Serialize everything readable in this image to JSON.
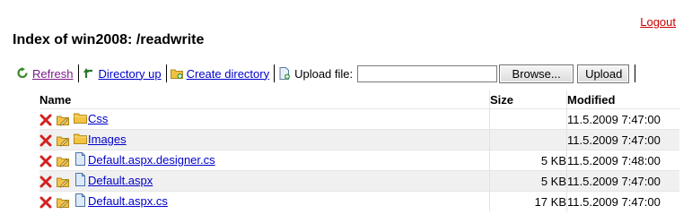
{
  "header": {
    "logout_label": "Logout",
    "title": "Index of win2008: /readwrite"
  },
  "toolbar": {
    "refresh_label": "Refresh",
    "directory_up_label": "Directory up",
    "create_directory_label": "Create directory",
    "upload_file_label": "Upload file:",
    "upload_input_value": "",
    "browse_label": "Browse...",
    "upload_label": "Upload"
  },
  "table": {
    "headers": {
      "name": "Name",
      "size": "Size",
      "modified": "Modified"
    },
    "rows": [
      {
        "name": "Css",
        "type": "folder",
        "size": "",
        "modified": "11.5.2009 7:47:00"
      },
      {
        "name": "Images",
        "type": "folder",
        "size": "",
        "modified": "11.5.2009 7:47:00"
      },
      {
        "name": "Default.aspx.designer.cs",
        "type": "file",
        "size": "5 KB",
        "modified": "11.5.2009 7:48:00"
      },
      {
        "name": "Default.aspx",
        "type": "file",
        "size": "5 KB",
        "modified": "11.5.2009 7:47:00"
      },
      {
        "name": "Default.aspx.cs",
        "type": "file",
        "size": "17 KB",
        "modified": "11.5.2009 7:47:00"
      }
    ]
  },
  "icons": {
    "refresh": "refresh-icon",
    "directory_up": "directory-up-icon",
    "create_directory": "new-folder-icon",
    "upload": "upload-file-icon",
    "delete": "delete-icon",
    "rename": "rename-icon",
    "folder": "folder-icon",
    "file": "file-icon"
  },
  "colors": {
    "link": "#0000cc",
    "visited_link": "#7b1c8a",
    "logout": "#cc0000",
    "delete": "#d42020",
    "folder": "#f0c040",
    "row_alt": "#f0f0f0"
  }
}
